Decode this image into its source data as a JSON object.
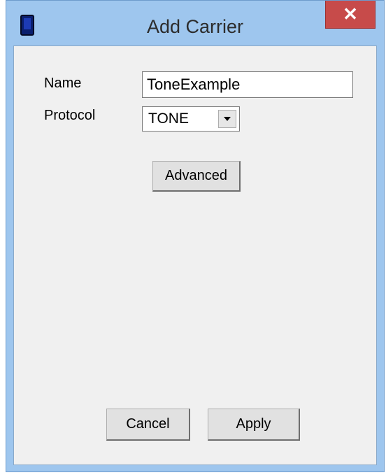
{
  "window": {
    "title": "Add Carrier",
    "close_label": "✕"
  },
  "form": {
    "name_label": "Name",
    "name_value": "ToneExample",
    "protocol_label": "Protocol",
    "protocol_value": "TONE",
    "advanced_label": "Advanced"
  },
  "footer": {
    "cancel_label": "Cancel",
    "apply_label": "Apply"
  },
  "icons": {
    "app": "device-icon",
    "close": "close-icon",
    "dropdown": "chevron-down-icon"
  }
}
